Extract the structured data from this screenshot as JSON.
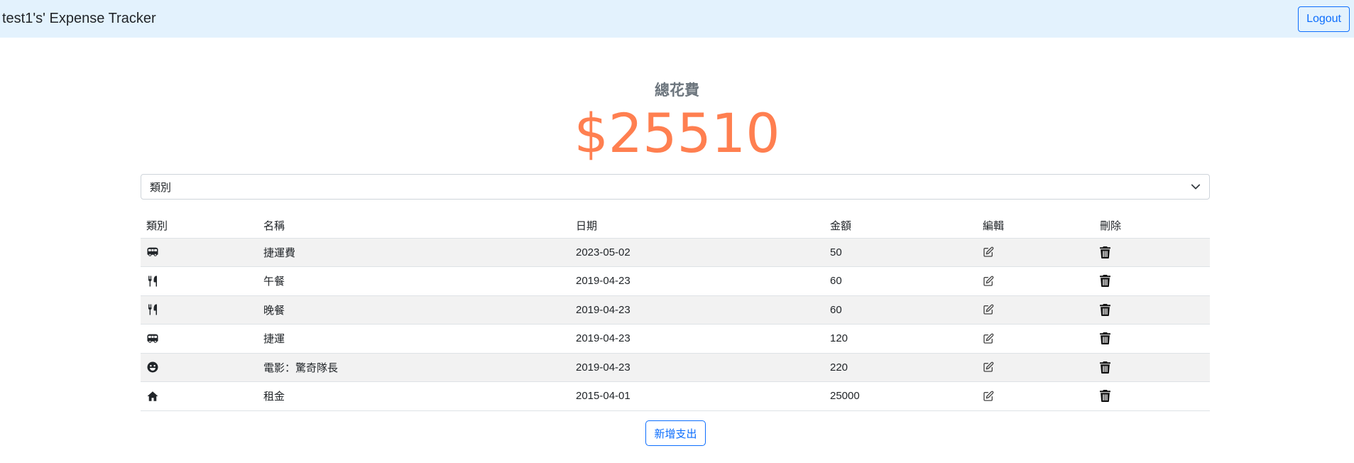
{
  "navbar": {
    "brand": "test1's' Expense Tracker",
    "logout_label": "Logout"
  },
  "summary": {
    "label": "總花費",
    "amount": "$25510"
  },
  "filter": {
    "selected": "類別"
  },
  "table": {
    "headers": {
      "category": "類別",
      "name": "名稱",
      "date": "日期",
      "amount": "金額",
      "edit": "編輯",
      "delete": "刪除"
    },
    "rows": [
      {
        "category_icon": "bus-icon",
        "name": "捷運費",
        "date": "2023-05-02",
        "amount": "50"
      },
      {
        "category_icon": "utensils-icon",
        "name": "午餐",
        "date": "2019-04-23",
        "amount": "60"
      },
      {
        "category_icon": "utensils-icon",
        "name": "晚餐",
        "date": "2019-04-23",
        "amount": "60"
      },
      {
        "category_icon": "bus-icon",
        "name": "捷運",
        "date": "2019-04-23",
        "amount": "120"
      },
      {
        "category_icon": "smile-icon",
        "name": "電影：驚奇隊長",
        "date": "2019-04-23",
        "amount": "220"
      },
      {
        "category_icon": "home-icon",
        "name": "租金",
        "date": "2015-04-01",
        "amount": "25000"
      }
    ]
  },
  "actions": {
    "add_label": "新增支出"
  },
  "colors": {
    "navbar_bg": "#e3f2fd",
    "accent": "#0d6efd",
    "total_amount": "#ff7f50",
    "row_stripe": "#f2f2f2"
  }
}
